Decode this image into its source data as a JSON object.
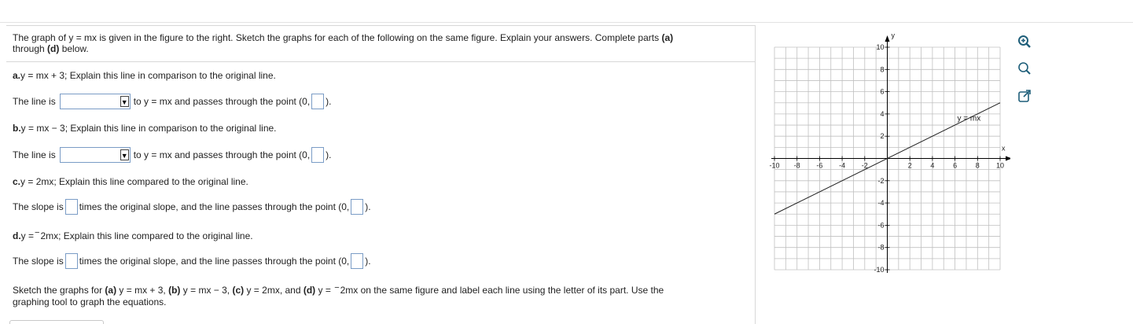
{
  "question": {
    "intro_before": "The graph of y = mx is given in the figure to the right. Sketch the graphs for each of the following on the same figure. Explain your answers. Complete parts ",
    "intro_bold": "(a)",
    "intro_line2_before": "through ",
    "intro_line2_bold": "(d)",
    "intro_line2_after": " below."
  },
  "part_a": {
    "letter": "a.",
    "prompt": " y = mx + 3; Explain this line in comparison to the original line.",
    "answer_prefix": "The line is",
    "answer_mid": "to y = mx and passes through the point (0,",
    "answer_suffix": ")."
  },
  "part_b": {
    "letter": "b.",
    "prompt": " y = mx − 3; Explain this line in comparison to the original line.",
    "answer_prefix": "The line is",
    "answer_mid": "to y = mx and passes through the point (0,",
    "answer_suffix": ")."
  },
  "part_c": {
    "letter": "c.",
    "prompt": " y = 2mx; Explain this line compared to the original line.",
    "answer_prefix": "The slope is",
    "answer_mid": "times the original slope, and the line passes through the point (0,",
    "answer_suffix": ")."
  },
  "part_d": {
    "letter": "d.",
    "prompt_before": " y = ",
    "neg_sign": "−",
    "prompt_after": "2mx; Explain this line compared to the original line.",
    "answer_prefix": "The slope is",
    "answer_mid": "times the original slope, and the line passes through the point (0,",
    "answer_suffix": ")."
  },
  "footer": {
    "s1": "Sketch the graphs for ",
    "a": "(a)",
    "s2": " y = mx + 3, ",
    "b": "(b)",
    "s3": " y = mx − 3, ",
    "c": "(c)",
    "s4": " y = 2mx, and ",
    "d": "(d)",
    "s5": " y = ",
    "neg": "−",
    "s6": "2mx on the same figure and label each line using the letter of its part. Use the",
    "line2": "graphing tool to graph the equations."
  },
  "graph": {
    "x_axis_label": "x",
    "y_axis_label": "y",
    "line_label": "y = mx",
    "x_ticks": [
      "-10",
      "-8",
      "-6",
      "-4",
      "-2",
      "2",
      "4",
      "6",
      "8",
      "10"
    ],
    "y_ticks": [
      "10",
      "8",
      "6",
      "4",
      "2",
      "-2",
      "-4",
      "-6",
      "-8",
      "-10"
    ],
    "x_range": [
      -10,
      10
    ],
    "y_range": [
      -10,
      10
    ],
    "line_start": [
      -10,
      -5
    ],
    "line_end": [
      10,
      5
    ],
    "grid": true,
    "axis_color": "#000000",
    "grid_color": "#c0c0c0",
    "line_color": "#222222"
  },
  "toolbar": {
    "zoom_in_icon": "zoom-in-icon",
    "zoom_out_icon": "zoom-out-icon",
    "popout_icon": "popout-icon"
  },
  "colors": {
    "input_border": "#7a9cc6",
    "icon_blue": "#1f5f7a"
  }
}
